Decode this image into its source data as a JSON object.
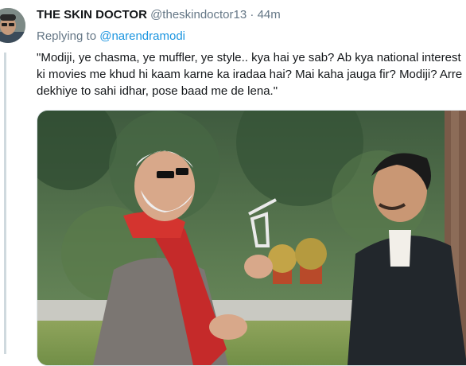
{
  "tweet": {
    "author_name": "THE SKIN DOCTOR",
    "author_handle": "@theskindoctor13",
    "separator": "·",
    "timestamp": "44m",
    "replying_prefix": "Replying to",
    "replying_to": "@narendramodi",
    "text_lines": [
      "\"Modiji, ye chasma, ye muffler, ye style.. kya hai ye sab? Ab kya national interest",
      "ki movies me khud hi kaam karne ka iradaa hai? Mai kaha jauga fir? Modiji? Arre",
      "dekhiye to sahi idhar, pose baad me de lena.\""
    ]
  },
  "icons": {
    "avatar": "profile-avatar"
  }
}
